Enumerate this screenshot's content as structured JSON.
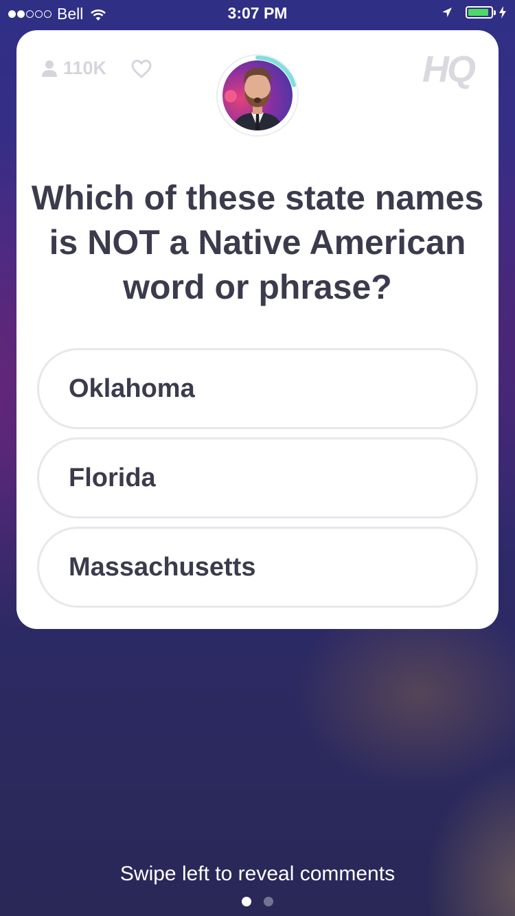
{
  "status_bar": {
    "carrier": "Bell",
    "time": "3:07 PM",
    "signal_filled": 2,
    "signal_total": 5,
    "battery_level": 0.92,
    "battery_color": "#4cd964"
  },
  "card": {
    "viewer_count": "110K",
    "logo": "HQ",
    "icons": [
      "person-icon",
      "heart-icon",
      "host-avatar"
    ],
    "question": "Which of these state names is NOT a Native American word or phrase?",
    "answers": [
      {
        "label": "Oklahoma"
      },
      {
        "label": "Florida"
      },
      {
        "label": "Massachusetts"
      }
    ]
  },
  "footer": {
    "hint": "Swipe left to reveal comments",
    "page_count": 2,
    "active_page": 1
  }
}
